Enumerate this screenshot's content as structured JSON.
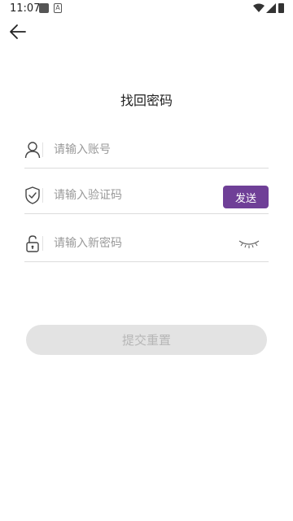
{
  "status_bar": {
    "time": "11:07",
    "icons": [
      "app-notification-icon",
      "a-notification-icon",
      "wifi-icon",
      "signal-icon",
      "battery-icon"
    ]
  },
  "header": {
    "back_icon": "arrow-left-icon",
    "title": "找回密码"
  },
  "form": {
    "account": {
      "placeholder": "请输入账号",
      "value": "",
      "icon": "user-icon"
    },
    "code": {
      "placeholder": "请输入验证码",
      "value": "",
      "icon": "shield-check-icon",
      "send_label": "发送"
    },
    "new_password": {
      "placeholder": "请输入新密码",
      "value": "",
      "icon": "unlock-icon",
      "toggle_icon": "eye-closed-icon"
    },
    "submit_label": "提交重置"
  },
  "colors": {
    "accent": "#6f3f97",
    "submit_disabled_bg": "#e3e3e3",
    "submit_disabled_text": "#b6b6b6"
  }
}
